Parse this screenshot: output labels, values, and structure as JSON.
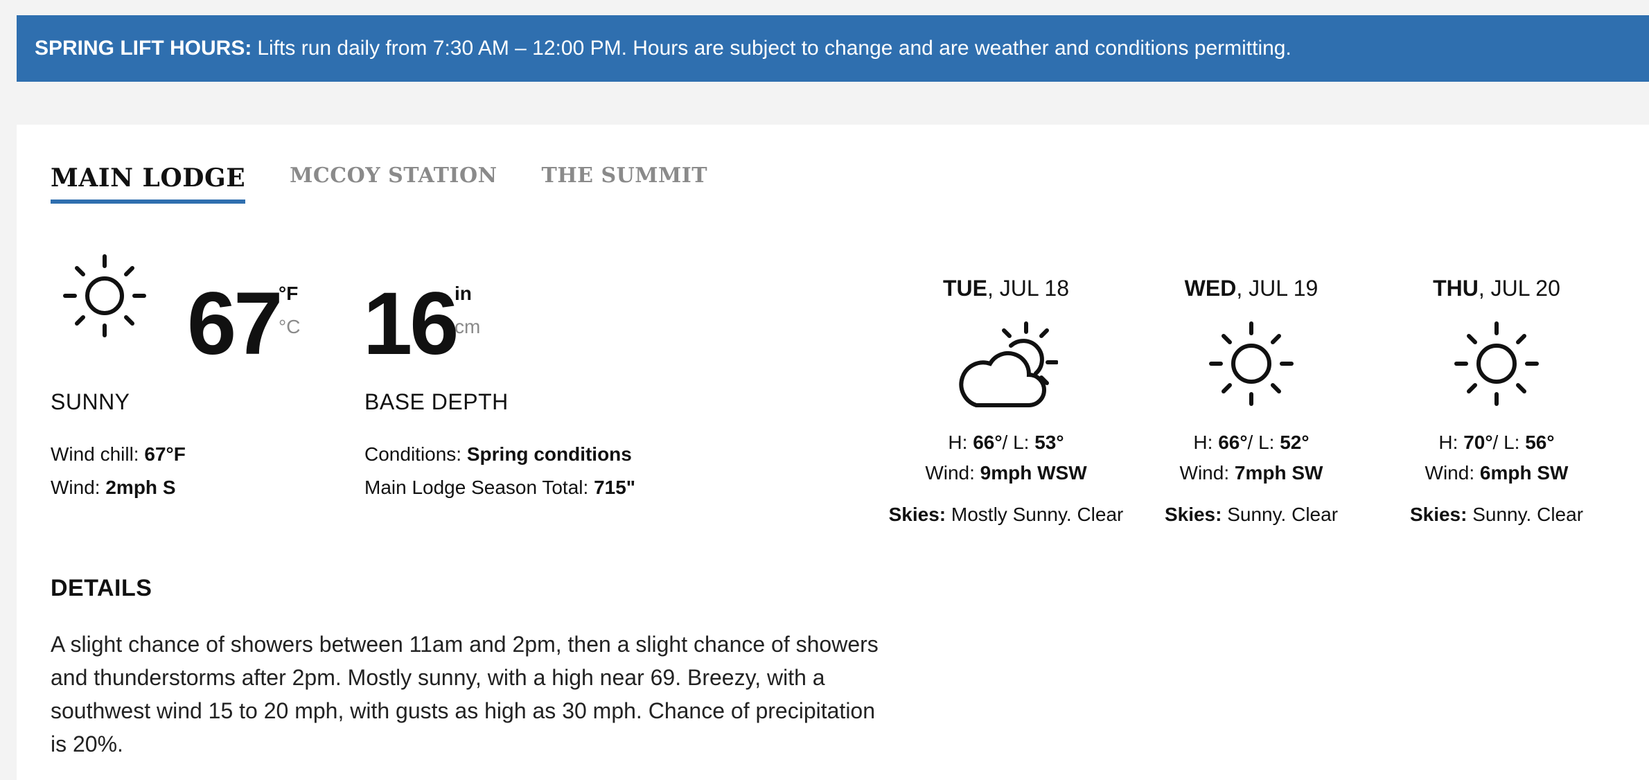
{
  "banner": {
    "label": "SPRING LIFT HOURS:",
    "text": "Lifts run daily from 7:30 AM – 12:00 PM. Hours are subject to change and are weather and conditions permitting."
  },
  "tabs": [
    {
      "label": "MAIN LODGE",
      "active": true
    },
    {
      "label": "MCCOY STATION",
      "active": false
    },
    {
      "label": "THE SUMMIT",
      "active": false
    }
  ],
  "current": {
    "icon": "sun-icon",
    "temperature": "67",
    "unit_primary": "°F",
    "unit_secondary": "°C",
    "condition": "SUNNY",
    "wind_chill_label": "Wind chill:",
    "wind_chill_value": "67°F",
    "wind_label": "Wind:",
    "wind_value": "2mph S"
  },
  "snow": {
    "depth": "16",
    "unit_primary": "in",
    "unit_secondary": "cm",
    "label": "BASE DEPTH",
    "conditions_label": "Conditions:",
    "conditions_value": "Spring conditions",
    "season_total_label": "Main Lodge Season Total:",
    "season_total_value": "715\""
  },
  "details": {
    "title": "DETAILS",
    "text": "A slight chance of showers between 11am and 2pm, then a slight chance of showers and thunderstorms after 2pm. Mostly sunny, with a high near 69. Breezy, with a southwest wind 15 to 20 mph, with gusts as high as 30 mph. Chance of precipitation is 20%."
  },
  "forecast": [
    {
      "day": "TUE",
      "date": ", JUL 18",
      "icon": "partly-cloudy-icon",
      "h_label": "H:",
      "high": "66°",
      "l_label": "/ L:",
      "low": "53°",
      "wind_label": "Wind:",
      "wind": "9mph WSW",
      "skies_label": "Skies:",
      "skies": "Mostly Sunny. Clear"
    },
    {
      "day": "WED",
      "date": ", JUL 19",
      "icon": "sun-icon",
      "h_label": "H:",
      "high": "66°",
      "l_label": "/ L:",
      "low": "52°",
      "wind_label": "Wind:",
      "wind": "7mph SW",
      "skies_label": "Skies:",
      "skies": "Sunny. Clear"
    },
    {
      "day": "THU",
      "date": ", JUL 20",
      "icon": "sun-icon",
      "h_label": "H:",
      "high": "70°",
      "l_label": "/ L:",
      "low": "56°",
      "wind_label": "Wind:",
      "wind": "6mph SW",
      "skies_label": "Skies:",
      "skies": "Sunny. Clear"
    }
  ],
  "colors": {
    "accent": "#2f6faf",
    "muted": "#8a8a8a"
  }
}
